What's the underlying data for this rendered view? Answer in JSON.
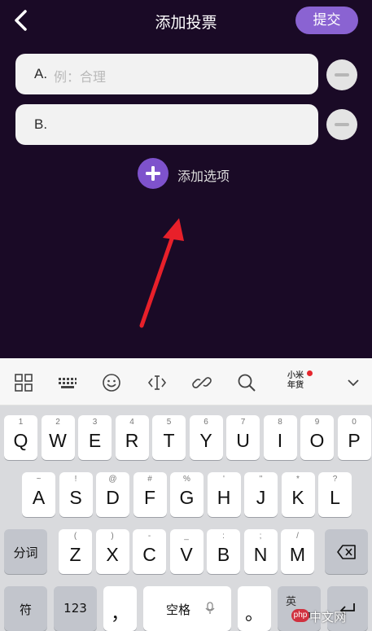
{
  "header": {
    "title": "添加投票",
    "submit_label": "提交"
  },
  "options": [
    {
      "prefix": "A.",
      "placeholder": "例：合理"
    },
    {
      "prefix": "B.",
      "placeholder": ""
    }
  ],
  "add_option_label": "添加选项",
  "toolbar": {
    "hongbao_line1": "小米",
    "hongbao_line2": "年货"
  },
  "keyboard": {
    "row1": [
      {
        "sub": "1",
        "main": "Q"
      },
      {
        "sub": "2",
        "main": "W"
      },
      {
        "sub": "3",
        "main": "E"
      },
      {
        "sub": "4",
        "main": "R"
      },
      {
        "sub": "5",
        "main": "T"
      },
      {
        "sub": "6",
        "main": "Y"
      },
      {
        "sub": "7",
        "main": "U"
      },
      {
        "sub": "8",
        "main": "I"
      },
      {
        "sub": "9",
        "main": "O"
      },
      {
        "sub": "0",
        "main": "P"
      }
    ],
    "row2": [
      {
        "sub": "~",
        "main": "A"
      },
      {
        "sub": "!",
        "main": "S"
      },
      {
        "sub": "@",
        "main": "D"
      },
      {
        "sub": "#",
        "main": "F"
      },
      {
        "sub": "%",
        "main": "G"
      },
      {
        "sub": "'",
        "main": "H"
      },
      {
        "sub": "\"",
        "main": "J"
      },
      {
        "sub": "*",
        "main": "K"
      },
      {
        "sub": "?",
        "main": "L"
      }
    ],
    "row3": [
      {
        "sub": "(",
        "main": "Z"
      },
      {
        "sub": ")",
        "main": "X"
      },
      {
        "sub": "-",
        "main": "C"
      },
      {
        "sub": "_",
        "main": "V"
      },
      {
        "sub": ":",
        "main": "B"
      },
      {
        "sub": ";",
        "main": "N"
      },
      {
        "sub": "/",
        "main": "M"
      }
    ],
    "fenci_label": "分词",
    "symbol_label": "符",
    "num_label": "123",
    "comma_label": "，",
    "space_label": "空格",
    "period_label": "。",
    "lang_en": "英",
    "lang_zh": "中"
  },
  "watermark": {
    "logo": "php",
    "text": "中文网"
  },
  "colors": {
    "background": "#1a0a26",
    "accent": "#8a63d2",
    "arrow": "#e8202a"
  }
}
